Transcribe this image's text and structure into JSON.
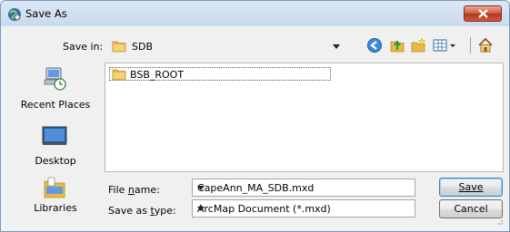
{
  "window": {
    "title": "Save As",
    "icon": "arcmap-globe-icon",
    "close_icon": "close-icon"
  },
  "toolbar": {
    "save_in_label": "Save in:",
    "save_in_value": "SDB",
    "icons": [
      "back-icon",
      "up-folder-icon",
      "new-folder-icon",
      "view-menu-icon",
      "home-icon"
    ]
  },
  "places": [
    {
      "label": "Recent Places",
      "icon": "recent-places-icon"
    },
    {
      "label": "Desktop",
      "icon": "desktop-icon"
    },
    {
      "label": "Libraries",
      "icon": "libraries-icon"
    }
  ],
  "files": [
    {
      "name": "BSB_ROOT",
      "icon": "folder-icon"
    }
  ],
  "form": {
    "file_name_label": "File name:",
    "file_name_value": "CapeAnn_MA_SDB.mxd",
    "save_type_label": "Save as type:",
    "save_type_value": "ArcMap Document (*.mxd)"
  },
  "buttons": {
    "save": "Save",
    "cancel": "Cancel"
  },
  "colors": {
    "close_button": "#c75a40",
    "folder": "#e8b94a",
    "default_button_border": "#3c7fb1"
  }
}
